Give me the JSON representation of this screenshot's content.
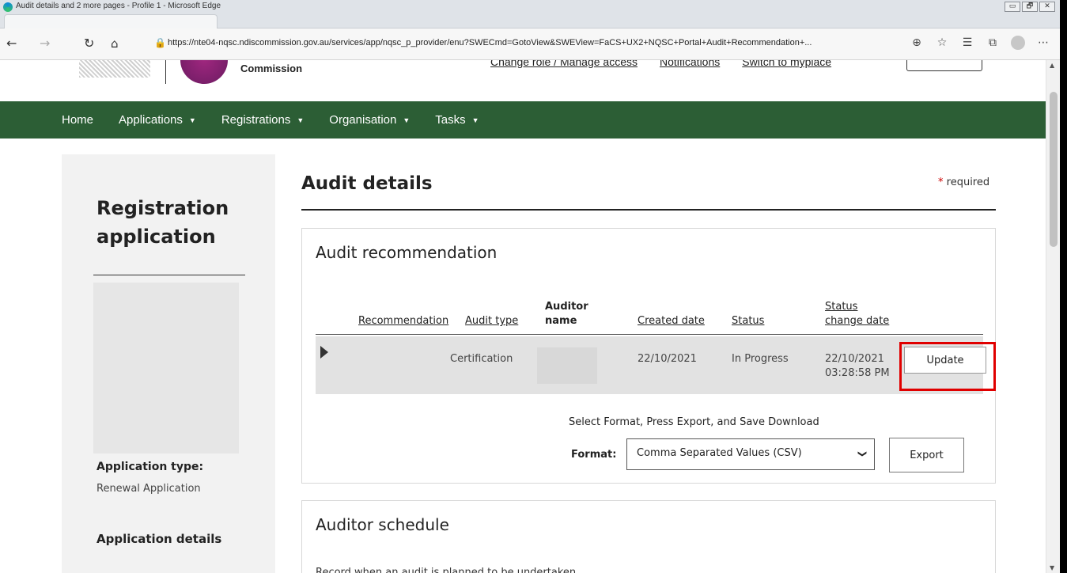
{
  "browser": {
    "title": "Audit details and 2 more pages - Profile 1 - Microsoft Edge",
    "url": "https://nte04-nqsc.ndiscommission.gov.au/services/app/nqsc_p_provider/enu?SWECmd=GotoView&SWEView=FaCS+UX2+NQSC+Portal+Audit+Recommendation+...",
    "win_minimize": "▭",
    "win_restore": "🗗",
    "win_close": "✕",
    "icons": [
      "back-icon",
      "forward-icon",
      "refresh-icon",
      "home-icon",
      "lock-icon",
      "zoom-icon",
      "favorite-add-icon",
      "favorites-icon",
      "collections-icon",
      "profile-icon",
      "more-icon"
    ]
  },
  "header": {
    "brand_text": "Commission",
    "links": [
      "Change role / Manage access",
      "Notifications",
      "Switch to myplace"
    ]
  },
  "nav": {
    "items": [
      "Home",
      "Applications",
      "Registrations",
      "Organisation",
      "Tasks"
    ]
  },
  "sidebar": {
    "title": "Registration application",
    "app_type_label": "Application type:",
    "app_type_value": "Renewal Application",
    "app_details": "Application details"
  },
  "page": {
    "title": "Audit details",
    "required_star": "*",
    "required_text": "required"
  },
  "audit_recommendation": {
    "heading": "Audit recommendation",
    "columns": {
      "recommendation": "Recommendation",
      "audit_type": "Audit type",
      "auditor_name_1": "Auditor",
      "auditor_name_2": "name",
      "created_date": "Created date",
      "status": "Status",
      "status_change_1": "Status",
      "status_change_2": "change date"
    },
    "row": {
      "audit_type": "Certification",
      "created_date": "22/10/2021",
      "status": "In Progress",
      "status_change_date_1": "22/10/2021",
      "status_change_date_2": "03:28:58 PM",
      "update_label": "Update"
    },
    "export_note": "Select Format, Press Export, and Save Download",
    "format_label": "Format:",
    "format_value": "Comma Separated Values (CSV)",
    "export_label": "Export"
  },
  "auditor_schedule": {
    "heading": "Auditor schedule",
    "cutoff_text": "Record when an audit is planned to be undertaken"
  },
  "colors": {
    "nav_green": "#2c5e35",
    "highlight_red": "#e00000"
  }
}
